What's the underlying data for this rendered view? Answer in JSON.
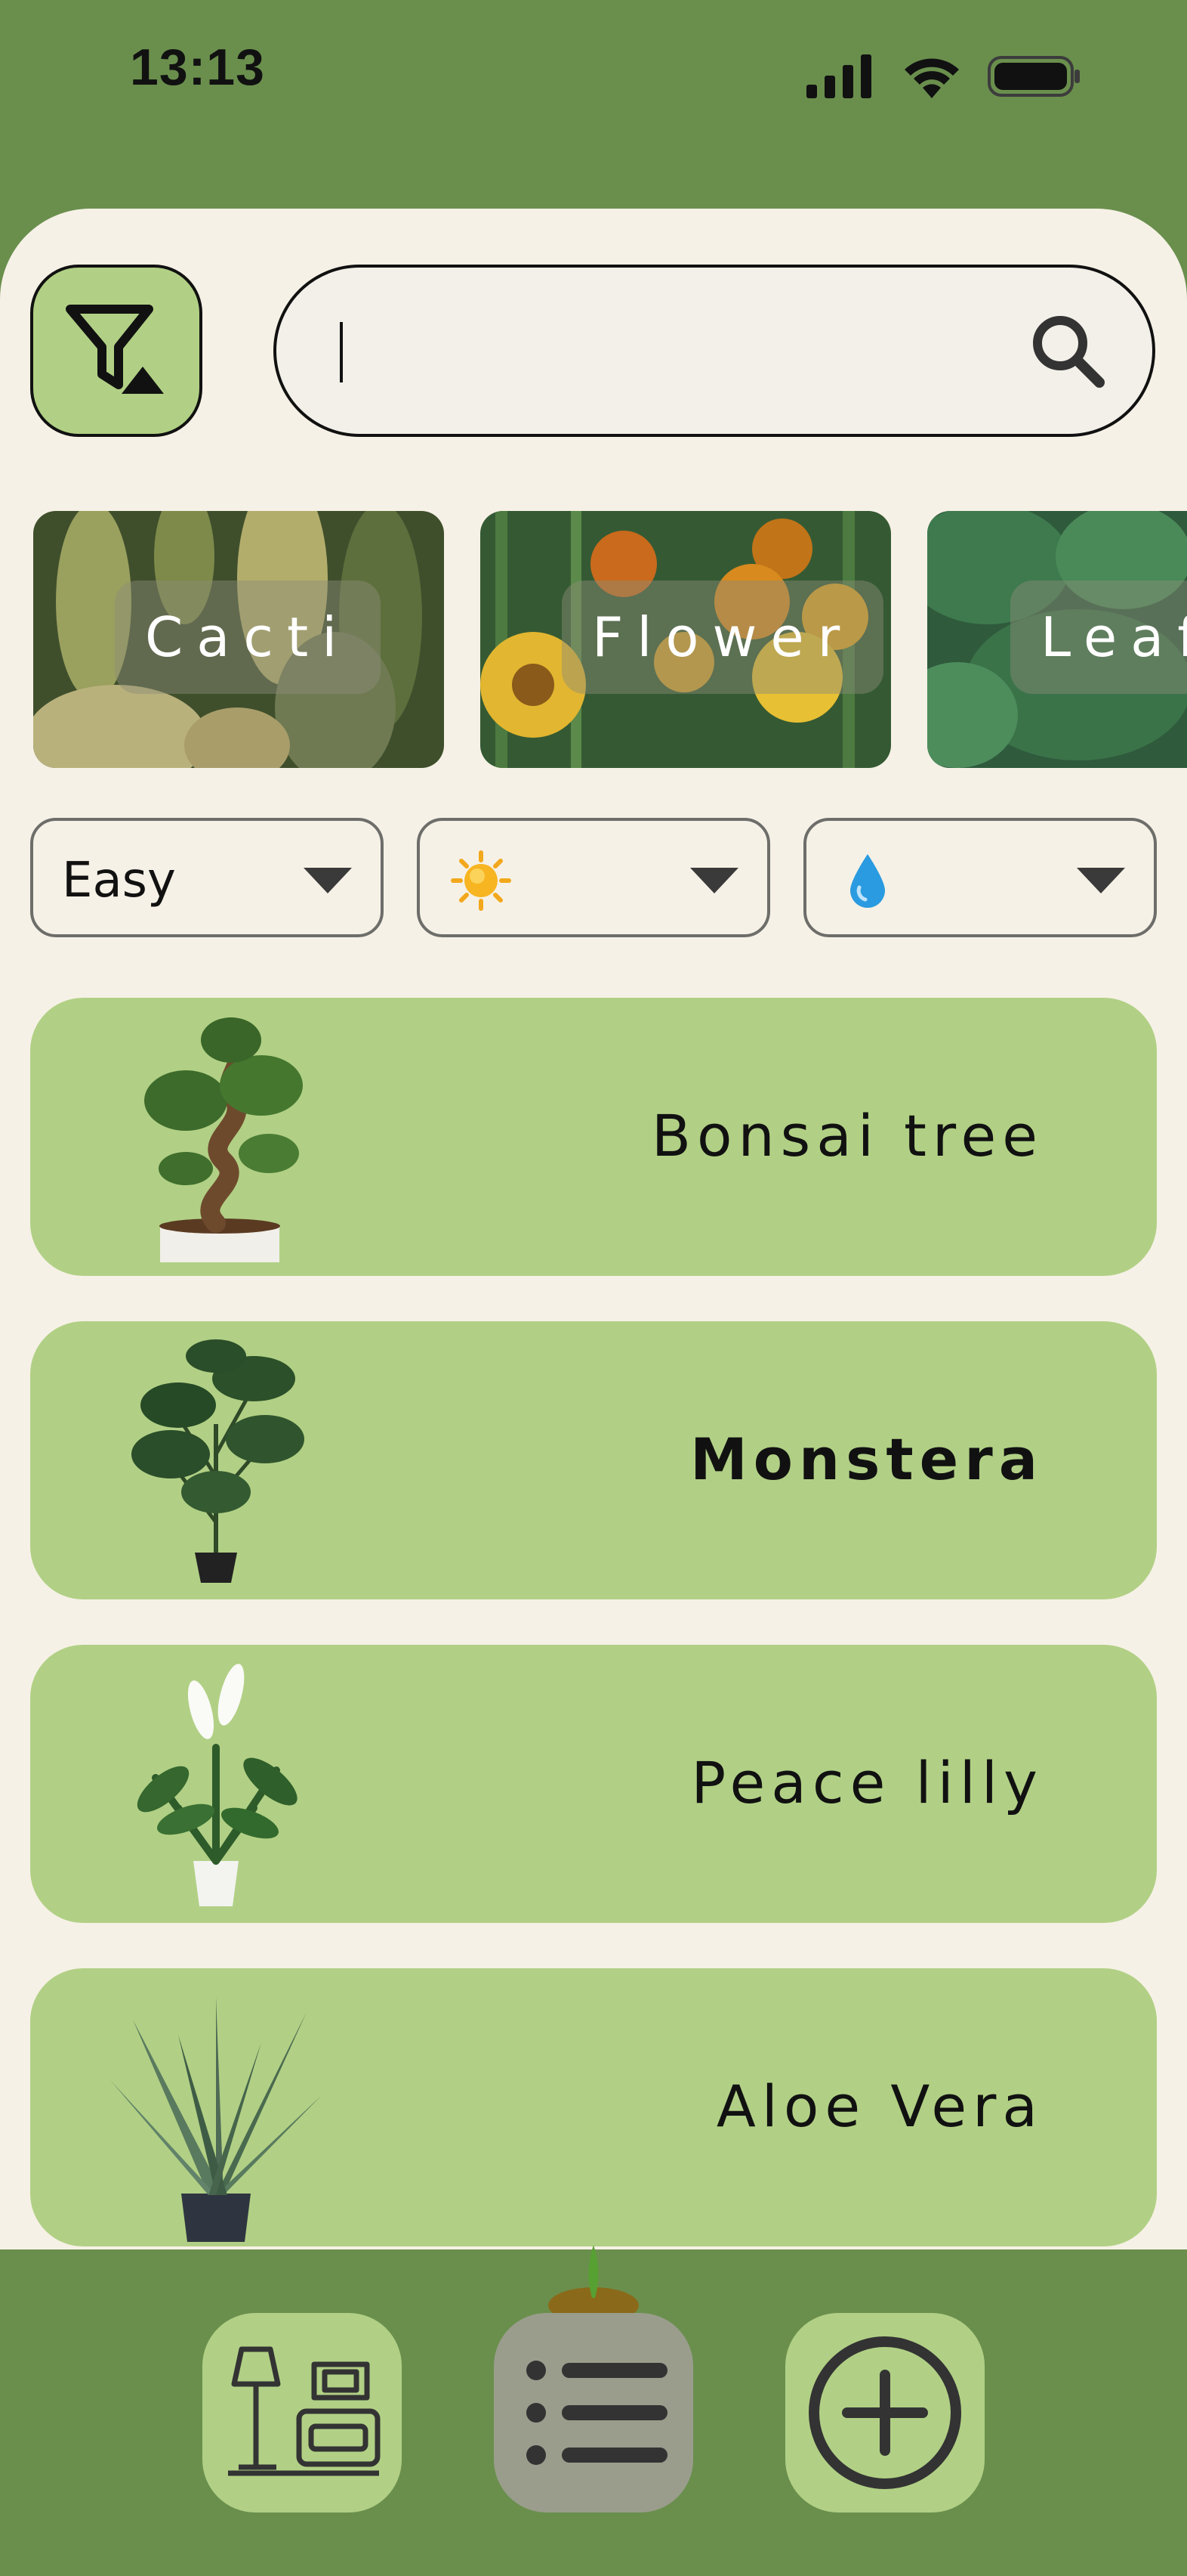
{
  "status_bar": {
    "time": "13:13"
  },
  "search": {
    "value": "",
    "placeholder": ""
  },
  "categories": [
    {
      "label": "Cacti"
    },
    {
      "label": "Flower"
    },
    {
      "label": "Leaf"
    }
  ],
  "filters": {
    "difficulty": "Easy",
    "light_icon": "sun-icon",
    "water_icon": "water-drop-icon"
  },
  "plants": [
    {
      "name": "Bonsai tree",
      "icon": "bonsai-image",
      "bold": false
    },
    {
      "name": "Monstera",
      "icon": "monstera-image",
      "bold": true
    },
    {
      "name": "Peace lilly",
      "icon": "peace-lily-image",
      "bold": false
    },
    {
      "name": "Aloe Vera",
      "icon": "aloe-vera-image",
      "bold": false
    }
  ],
  "bottom_nav": [
    {
      "icon": "living-room-icon",
      "active": false
    },
    {
      "icon": "list-icon",
      "active": true
    },
    {
      "icon": "add-circle-icon",
      "active": false
    }
  ],
  "colors": {
    "header_green": "#6a8f4d",
    "card_green": "#b1d085",
    "sheet_cream": "#f6f1e6",
    "active_nav": "#9a9d8c"
  }
}
